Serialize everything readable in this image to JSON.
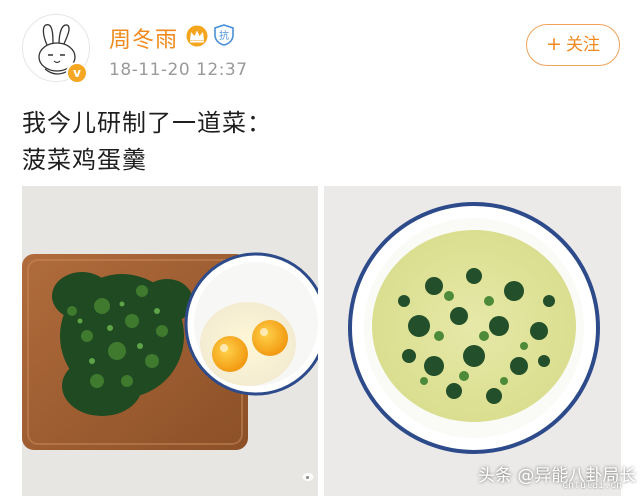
{
  "post": {
    "author": {
      "name": "周冬雨",
      "avatar_icon": "rabbit-avatar-icon",
      "verified_badge": "v",
      "vip_icon": "crown-icon",
      "anti_badge": "抗"
    },
    "timestamp": "18-11-20 12:37",
    "follow_label": "关注",
    "follow_plus": "+",
    "text_lines": [
      "我今儿研制了一道菜：",
      "菠菜鸡蛋羹"
    ],
    "images": [
      {
        "name": "spinach-and-eggs-photo"
      },
      {
        "name": "steamed-egg-custard-photo"
      }
    ]
  },
  "watermark": {
    "text": "头条 @异能八卦局长",
    "site": "cnfulai.cn"
  },
  "colors": {
    "accent": "#f08a1f",
    "timestamp": "#9a9a9a",
    "text": "#1e1e1e"
  }
}
